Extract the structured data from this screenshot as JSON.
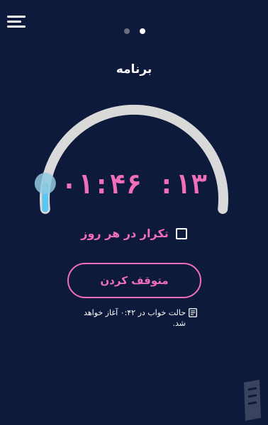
{
  "header": {
    "menu_icon": "hamburger-menu-icon",
    "pager": {
      "count": 2,
      "active_index": 1
    }
  },
  "page": {
    "title": "برنامه"
  },
  "timer": {
    "display": "۰۱:۴۶ :۱۳",
    "progress_fraction": 0.02
  },
  "repeat": {
    "label": "تکرار در هر روز",
    "checked": false
  },
  "actions": {
    "stop_label": "متوقف کردن"
  },
  "note": {
    "icon": "document-icon",
    "text": "حالت خواب در ۰:۴۲ آغاز خواهد شد."
  },
  "watermark_icon": "app-logo-icon",
  "colors": {
    "background": "#0e1a3b",
    "accent_pink": "#f06fb8",
    "track_gray": "#d9d9d9",
    "progress_blue": "#5bc6f2",
    "knob_blue": "#8fc9df",
    "dot_inactive": "#6b6f7f",
    "dot_active": "#ffffff"
  }
}
